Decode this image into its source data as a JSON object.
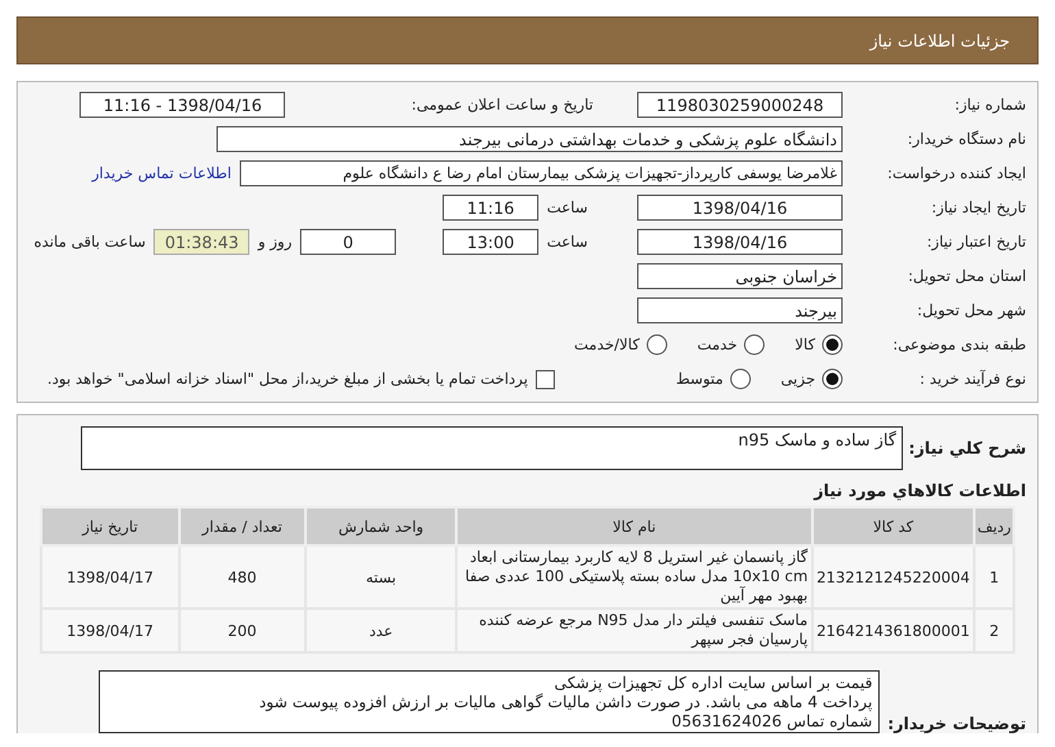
{
  "header": {
    "title": "جزئیات اطلاعات نیاز"
  },
  "form": {
    "need_number": {
      "label": "شماره نیاز:",
      "value": "1198030259000248"
    },
    "announce": {
      "label": "تاریخ و ساعت اعلان عمومی:",
      "value": "1398/04/16 - 11:16"
    },
    "buyer_org": {
      "label": "نام دستگاه خریدار:",
      "value": "دانشگاه علوم پزشکی و خدمات بهداشتی درمانی بیرجند"
    },
    "requester": {
      "label": "ایجاد کننده درخواست:",
      "value": "غلامرضا یوسفی کارپرداز-تجهیزات پزشکی بیمارستان امام رضا ع دانشگاه علوم",
      "link": "اطلاعات تماس خریدار"
    },
    "created": {
      "label": "تاریخ ایجاد نیاز:",
      "date": "1398/04/16",
      "time_label": "ساعت",
      "time": "11:16"
    },
    "validity": {
      "label": "تاریخ اعتبار نیاز:",
      "date": "1398/04/16",
      "time_label": "ساعت",
      "time": "13:00",
      "days": "0",
      "days_label": "روز و",
      "remaining": "01:38:43",
      "remaining_label": "ساعت باقی مانده"
    },
    "province": {
      "label": "استان محل تحویل:",
      "value": "خراسان جنوبی"
    },
    "city": {
      "label": "شهر محل تحویل:",
      "value": "بیرجند"
    },
    "category": {
      "label": "طبقه بندی موضوعی:",
      "options": [
        {
          "label": "کالا",
          "selected": true
        },
        {
          "label": "خدمت",
          "selected": false
        },
        {
          "label": "کالا/خدمت",
          "selected": false
        }
      ]
    },
    "process": {
      "label": "نوع فرآیند خرید :",
      "options": [
        {
          "label": "جزیی",
          "selected": true
        },
        {
          "label": "متوسط",
          "selected": false
        }
      ],
      "payment": {
        "checked": false,
        "label": "پرداخت تمام یا بخشی از مبلغ خرید،از محل \"اسناد خزانه اسلامی\" خواهد بود."
      }
    }
  },
  "description": {
    "label": "شرح کلي نياز:",
    "value": "گاز ساده و ماسک n95"
  },
  "items": {
    "title": "اطلاعات کالاهاي مورد نياز",
    "columns": [
      "ردیف",
      "کد کالا",
      "نام کالا",
      "واحد شمارش",
      "تعداد / مقدار",
      "تاریخ نیاز"
    ],
    "rows": [
      [
        "1",
        "2132121245220004",
        "گاز پانسمان غیر استریل 8 لایه کاربرد بیمارستانی ابعاد 10x10 cm مدل ساده بسته پلاستیکی 100 عددی صفا بهبود مهر آیین",
        "بسته",
        "480",
        "1398/04/17"
      ],
      [
        "2",
        "2164214361800001",
        "ماسک تنفسی فیلتر دار مدل N95 مرجع عرضه کننده پارسیان فجر سپهر",
        "عدد",
        "200",
        "1398/04/17"
      ]
    ]
  },
  "buyer_notes": {
    "label": "توضیحات خریدار:",
    "lines": [
      "قیمت بر اساس سایت اداره کل تجهیزات پزشکی",
      "پرداخت 4 ماهه می باشد. در صورت داشن مالیات گواهی مالیات بر ارزش افزوده پیوست شود",
      "شماره تماس 05631624026"
    ]
  }
}
